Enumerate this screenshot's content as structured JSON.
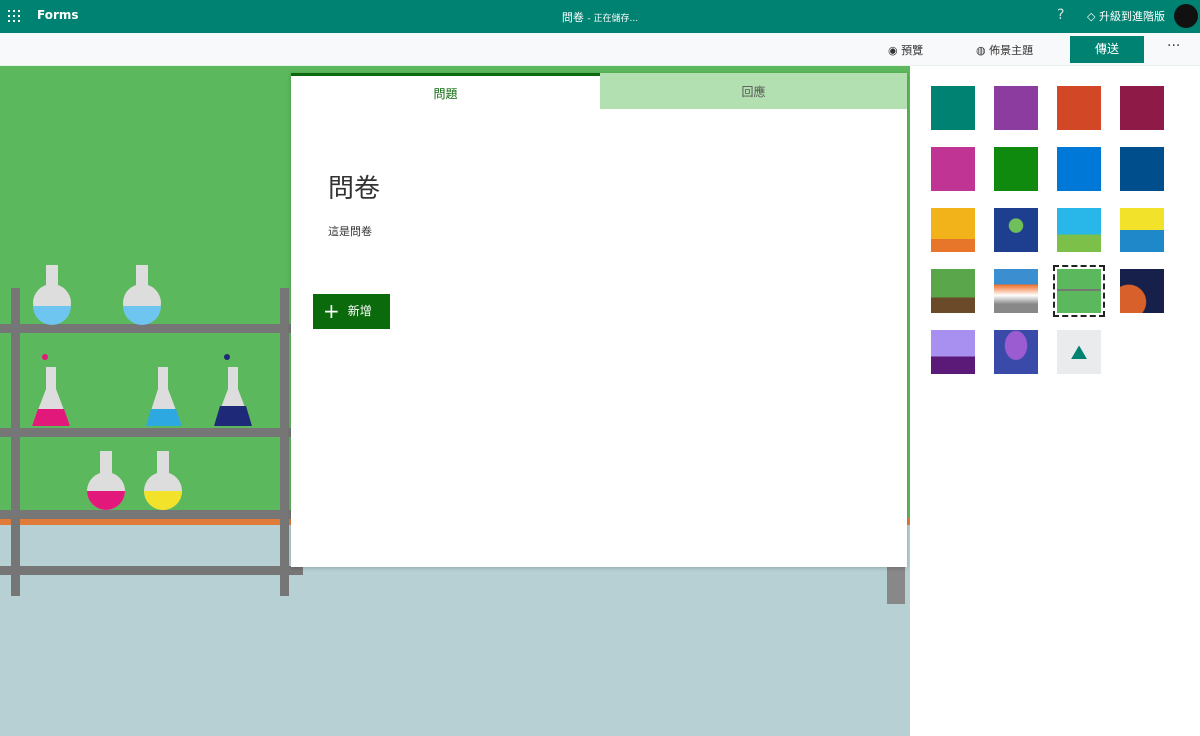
{
  "header": {
    "app": "Forms",
    "title": "問卷",
    "status": "- 正在儲存...",
    "help": "?",
    "upgrade": "升級到進階版"
  },
  "toolbar": {
    "preview": "預覽",
    "theme": "佈景主題",
    "send": "傳送",
    "more": "···"
  },
  "form": {
    "tabs": [
      "問題",
      "回應"
    ],
    "title": "問卷",
    "description": "這是問卷",
    "add_label": "新增"
  },
  "themes": {
    "colors": [
      "#008272",
      "#8b3c9e",
      "#d24726",
      "#8e1a48",
      "#c03593",
      "#0f8a0f",
      "#0078d7",
      "#004e8c"
    ],
    "images": [
      "living-room",
      "octopus",
      "sky-hills",
      "snowboarder",
      "park",
      "van",
      "lab-flasks",
      "space",
      "desk",
      "keyboard"
    ],
    "selected": "lab-flasks"
  }
}
